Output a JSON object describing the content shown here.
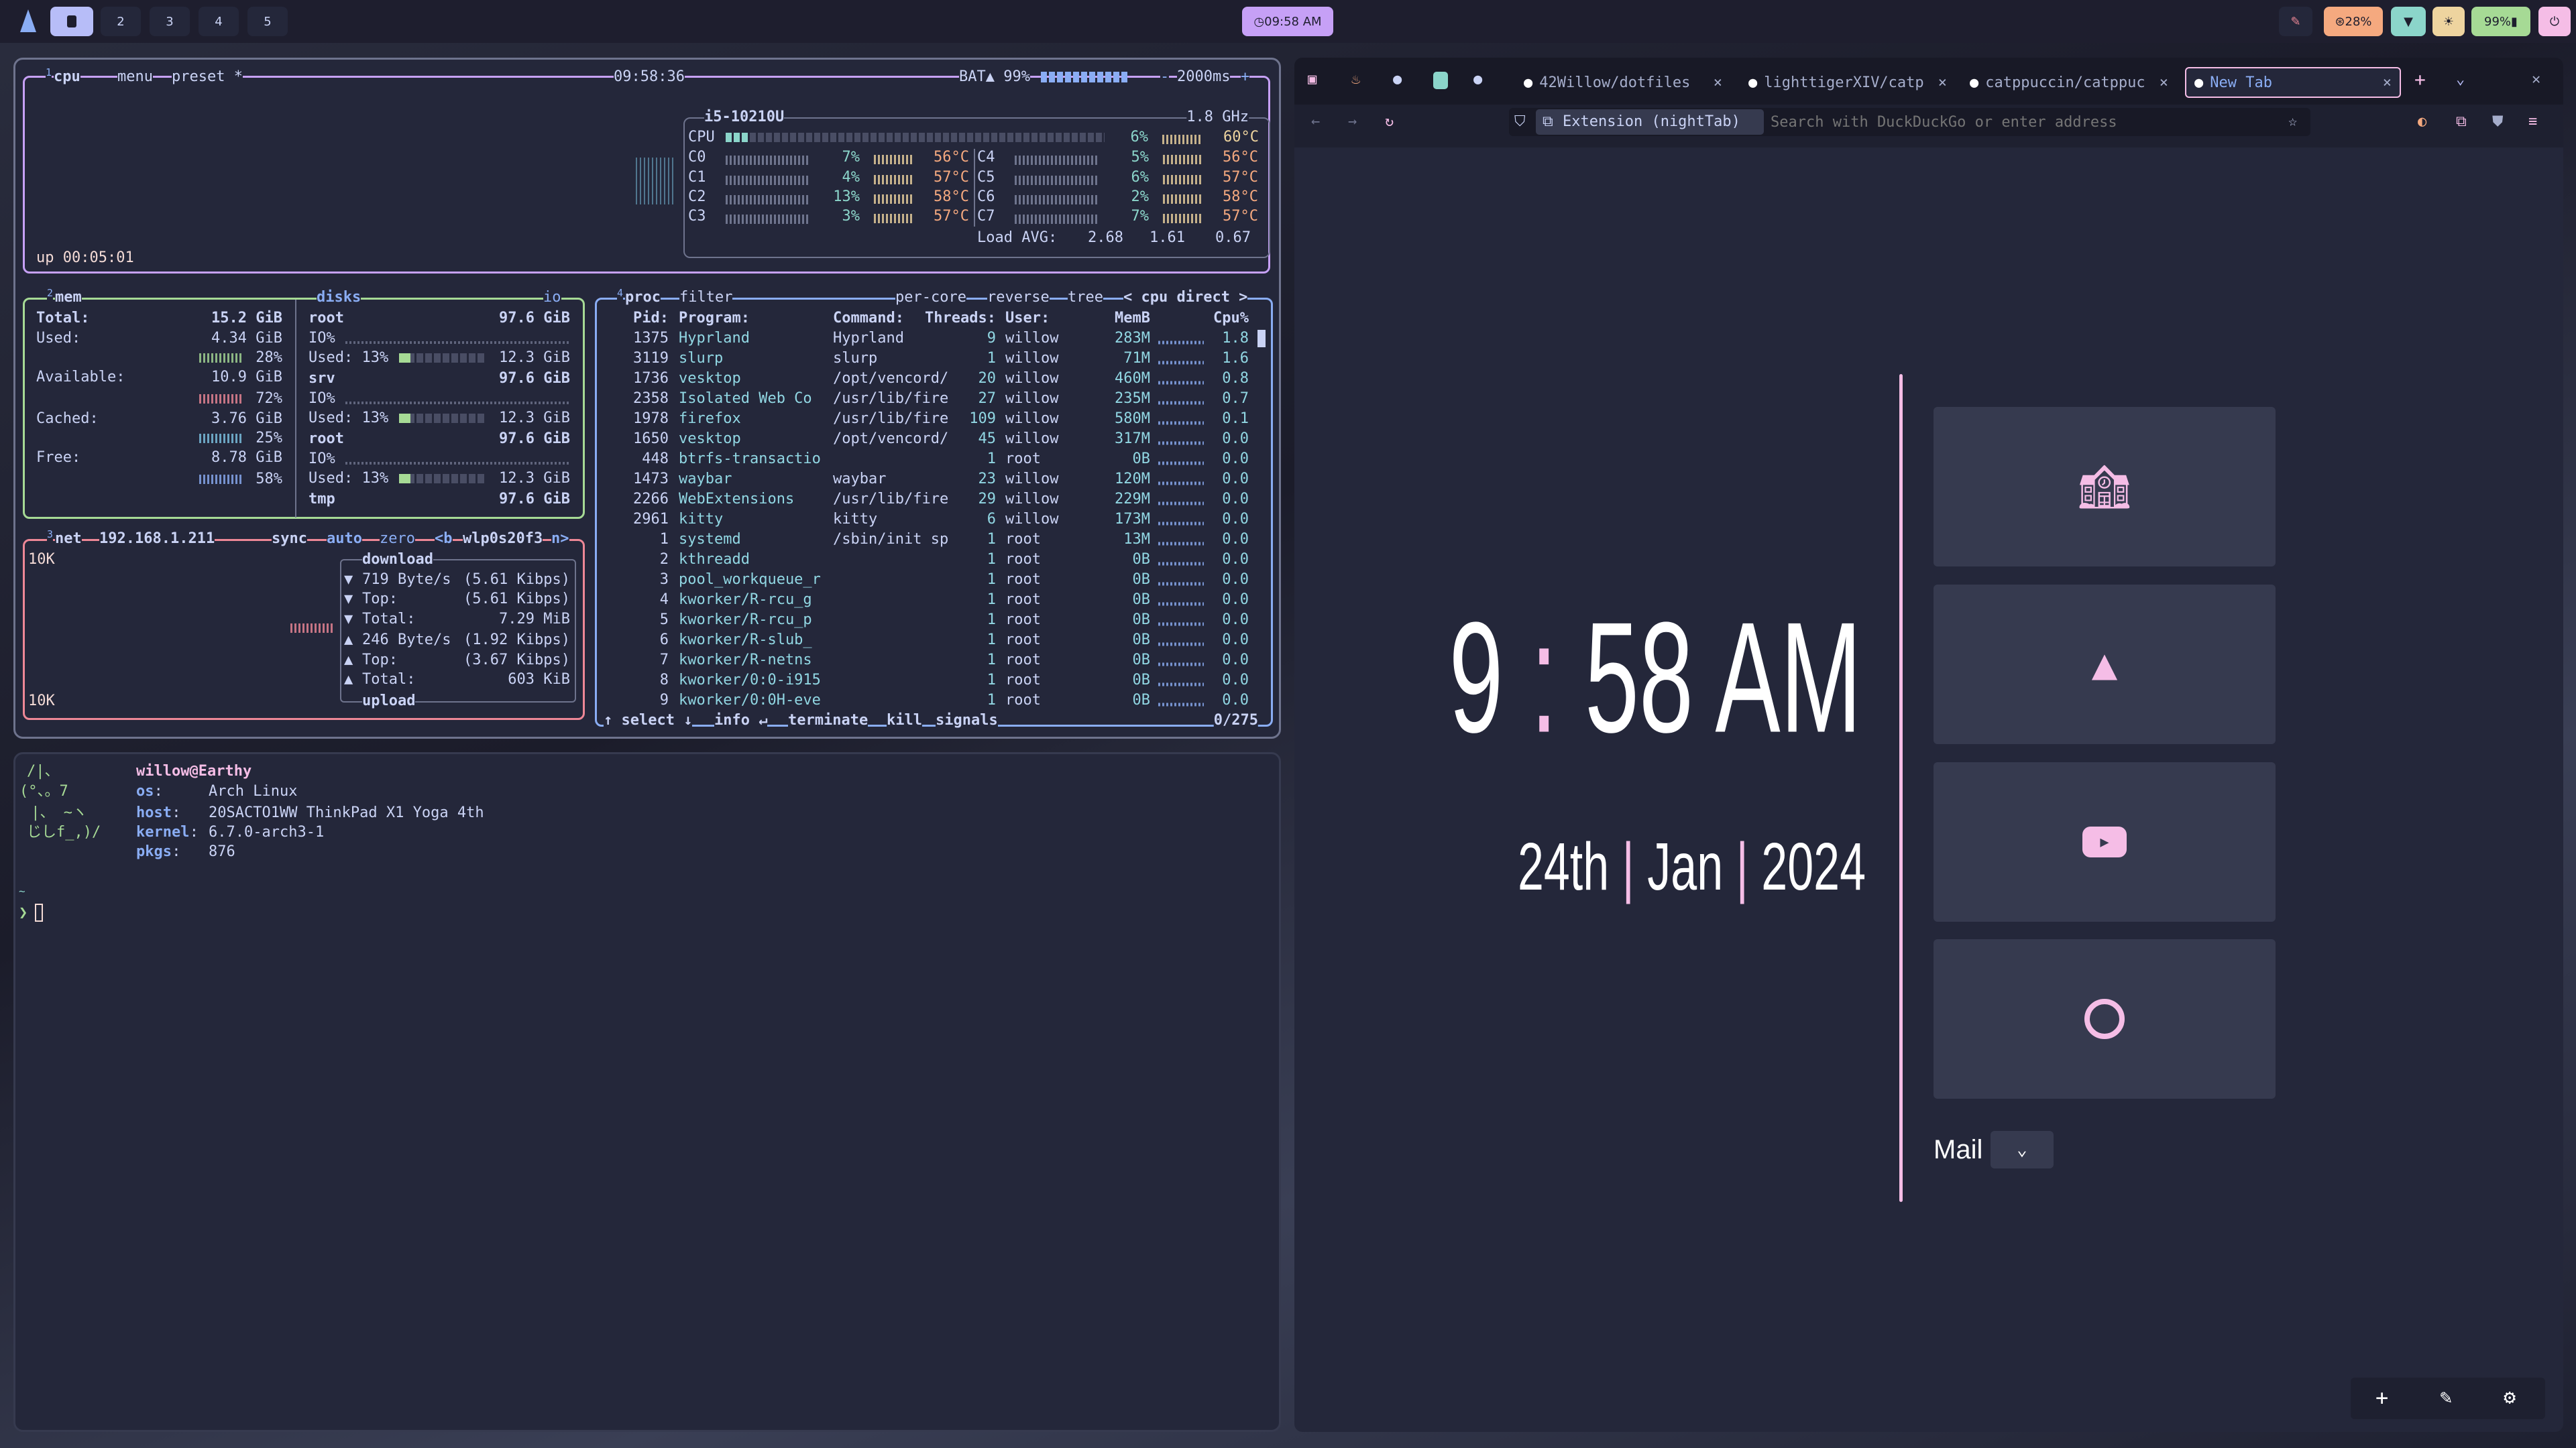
{
  "topbar": {
    "workspaces": [
      "2",
      "3",
      "4",
      "5"
    ],
    "active_workspace_icon": "square-icon",
    "clock": "09:58 AM",
    "cpu": "28%",
    "battery": "99%",
    "colors": {
      "clock": "#c6a0f6",
      "cpu": "#f5a97f",
      "wifi": "#8bd5ca",
      "brightness": "#eed49f",
      "battery": "#a6da95",
      "power": "#f5bde6"
    }
  },
  "btop": {
    "cpu": {
      "num": "1",
      "title": "cpu",
      "menu": "menu",
      "preset": "preset *",
      "clock": "09:58:36",
      "battery": "BAT▲ 99%",
      "interval_minus": "-",
      "interval": "2000ms",
      "interval_plus": "+",
      "model": "i5-10210U",
      "freq": "1.8 GHz",
      "total": {
        "label": "CPU",
        "pct": "6%",
        "temp": "60°C",
        "fill": 0.06
      },
      "cores": [
        {
          "label": "C0",
          "pct": "7%",
          "temp": "56°C"
        },
        {
          "label": "C1",
          "pct": "4%",
          "temp": "57°C"
        },
        {
          "label": "C2",
          "pct": "13%",
          "temp": "58°C"
        },
        {
          "label": "C3",
          "pct": "3%",
          "temp": "57°C"
        },
        {
          "label": "C4",
          "pct": "5%",
          "temp": "56°C"
        },
        {
          "label": "C5",
          "pct": "6%",
          "temp": "57°C"
        },
        {
          "label": "C6",
          "pct": "2%",
          "temp": "58°C"
        },
        {
          "label": "C7",
          "pct": "7%",
          "temp": "57°C"
        }
      ],
      "load_label": "Load AVG:",
      "load": [
        "2.68",
        "1.61",
        "0.67"
      ],
      "uptime": "up 00:05:01"
    },
    "mem": {
      "num": "2",
      "title": "mem",
      "rows": [
        {
          "label": "Total:",
          "value": "15.2 GiB"
        },
        {
          "label": "Used:",
          "value": "4.34 GiB",
          "pct": "28%",
          "color": "#a6da95"
        },
        {
          "label": "Available:",
          "value": "10.9 GiB",
          "pct": "72%",
          "color": "#ed8796"
        },
        {
          "label": "Cached:",
          "value": "3.76 GiB",
          "pct": "25%",
          "color": "#7dc4e4"
        },
        {
          "label": "Free:",
          "value": "8.78 GiB",
          "pct": "58%",
          "color": "#8aadf4"
        }
      ]
    },
    "disks": {
      "title": "disks",
      "io": "io",
      "items": [
        {
          "name": "root",
          "size": "97.6 GiB",
          "io": "IO%",
          "used": "Used: 13%",
          "used_size": "12.3 GiB",
          "fill": 0.13
        },
        {
          "name": "srv",
          "size": "97.6 GiB",
          "io": "IO%",
          "used": "Used: 13%",
          "used_size": "12.3 GiB",
          "fill": 0.13
        },
        {
          "name": "root",
          "size": "97.6 GiB",
          "io": "IO%",
          "used": "Used: 13%",
          "used_size": "12.3 GiB",
          "fill": 0.13
        }
      ],
      "last": {
        "name": "tmp",
        "size": "97.6 GiB"
      }
    },
    "net": {
      "num": "3",
      "title": "net",
      "ip": "192.168.1.211",
      "sync": "sync",
      "auto": "auto",
      "zero": "zero",
      "iface_prev": "<b",
      "iface": "wlp0s20f3",
      "iface_next": "n>",
      "scale_top": "10K",
      "scale_bottom": "10K",
      "download_label": "download",
      "upload_label": "upload",
      "stats": [
        {
          "arrow": "▼",
          "label": "719 Byte/s",
          "value": "(5.61 Kibps)"
        },
        {
          "arrow": "▼",
          "label": "Top:",
          "value": "(5.61 Kibps)"
        },
        {
          "arrow": "▼",
          "label": "Total:",
          "value": "7.29 MiB"
        },
        {
          "arrow": "▲",
          "label": "246 Byte/s",
          "value": "(1.92 Kibps)"
        },
        {
          "arrow": "▲",
          "label": "Top:",
          "value": "(3.67 Kibps)"
        },
        {
          "arrow": "▲",
          "label": "Total:",
          "value": "603 KiB"
        }
      ]
    },
    "proc": {
      "num": "4",
      "title": "proc",
      "filter": "filter",
      "per_core": "per-core",
      "reverse": "reverse",
      "tree": "tree",
      "sort": "< cpu direct >",
      "headers": {
        "pid": "Pid:",
        "program": "Program:",
        "command": "Command:",
        "threads": "Threads:",
        "user": "User:",
        "mem": "MemB",
        "cpu": "Cpu%"
      },
      "rows": [
        [
          "1375",
          "Hyprland",
          "Hyprland",
          "9",
          "willow",
          "283M",
          "1.8"
        ],
        [
          "3119",
          "slurp",
          "slurp",
          "1",
          "willow",
          "71M",
          "1.6"
        ],
        [
          "1736",
          "vesktop",
          "/opt/vencord/",
          "20",
          "willow",
          "460M",
          "0.8"
        ],
        [
          "2358",
          "Isolated Web Co",
          "/usr/lib/fire",
          "27",
          "willow",
          "235M",
          "0.7"
        ],
        [
          "1978",
          "firefox",
          "/usr/lib/fire",
          "109",
          "willow",
          "580M",
          "0.1"
        ],
        [
          "1650",
          "vesktop",
          "/opt/vencord/",
          "45",
          "willow",
          "317M",
          "0.0"
        ],
        [
          "448",
          "btrfs-transactio",
          "",
          "1",
          "root",
          "0B",
          "0.0"
        ],
        [
          "1473",
          "waybar",
          "waybar",
          "23",
          "willow",
          "120M",
          "0.0"
        ],
        [
          "2266",
          "WebExtensions",
          "/usr/lib/fire",
          "29",
          "willow",
          "229M",
          "0.0"
        ],
        [
          "2961",
          "kitty",
          "kitty",
          "6",
          "willow",
          "173M",
          "0.0"
        ],
        [
          "1",
          "systemd",
          "/sbin/init sp",
          "1",
          "root",
          "13M",
          "0.0"
        ],
        [
          "2",
          "kthreadd",
          "",
          "1",
          "root",
          "0B",
          "0.0"
        ],
        [
          "3",
          "pool_workqueue_r",
          "",
          "1",
          "root",
          "0B",
          "0.0"
        ],
        [
          "4",
          "kworker/R-rcu_g",
          "",
          "1",
          "root",
          "0B",
          "0.0"
        ],
        [
          "5",
          "kworker/R-rcu_p",
          "",
          "1",
          "root",
          "0B",
          "0.0"
        ],
        [
          "6",
          "kworker/R-slub_",
          "",
          "1",
          "root",
          "0B",
          "0.0"
        ],
        [
          "7",
          "kworker/R-netns",
          "",
          "1",
          "root",
          "0B",
          "0.0"
        ],
        [
          "8",
          "kworker/0:0-i915",
          "",
          "1",
          "root",
          "0B",
          "0.0"
        ],
        [
          "9",
          "kworker/0:0H-eve",
          "",
          "1",
          "root",
          "0B",
          "0.0"
        ]
      ],
      "footer": {
        "select": "↑ select ↓",
        "info": "info ↵",
        "terminate": "terminate",
        "kill": "kill",
        "signals": "signals",
        "count": "0/275"
      }
    }
  },
  "terminal": {
    "ascii": [
      "/|、",
      "(°、。7",
      " |、 ~ヽ",
      "じしf_,)/"
    ],
    "user_host": "willow@Earthy",
    "info": [
      {
        "key": "os",
        "value": "Arch Linux"
      },
      {
        "key": "host",
        "value": "20SACTO1WW ThinkPad X1 Yoga 4th"
      },
      {
        "key": "kernel",
        "value": "6.7.0-arch3-1"
      },
      {
        "key": "pkgs",
        "value": "876"
      }
    ],
    "cwd": "~",
    "prompt": "❯"
  },
  "browser": {
    "tabs": [
      {
        "title": "42Willow/dotfiles",
        "icon": "github-icon"
      },
      {
        "title": "lighttigerXIV/catp",
        "icon": "github-icon"
      },
      {
        "title": "catppuccin/catppuc",
        "icon": "github-icon"
      },
      {
        "title": "New Tab",
        "icon": "firefox-icon",
        "active": true
      }
    ],
    "pinned_icons": [
      "sidebar-icon",
      "rooster-icon",
      "github-icon",
      "chatgpt-icon",
      "github-icon"
    ],
    "identity": "Extension (nightTab)",
    "url_placeholder": "Search with DuckDuckGo or enter address",
    "new_tab_page": {
      "time": {
        "hour": "9",
        "sep": ":",
        "minute": "58",
        "ampm": "AM"
      },
      "date": {
        "day": "24th",
        "sep": "|",
        "month": "Jan",
        "year": "2024"
      },
      "tiles": [
        "school-icon",
        "google-drive-icon",
        "youtube-icon",
        "github-icon"
      ],
      "search_engine": "Mail",
      "accent": "#f5bde6"
    }
  }
}
